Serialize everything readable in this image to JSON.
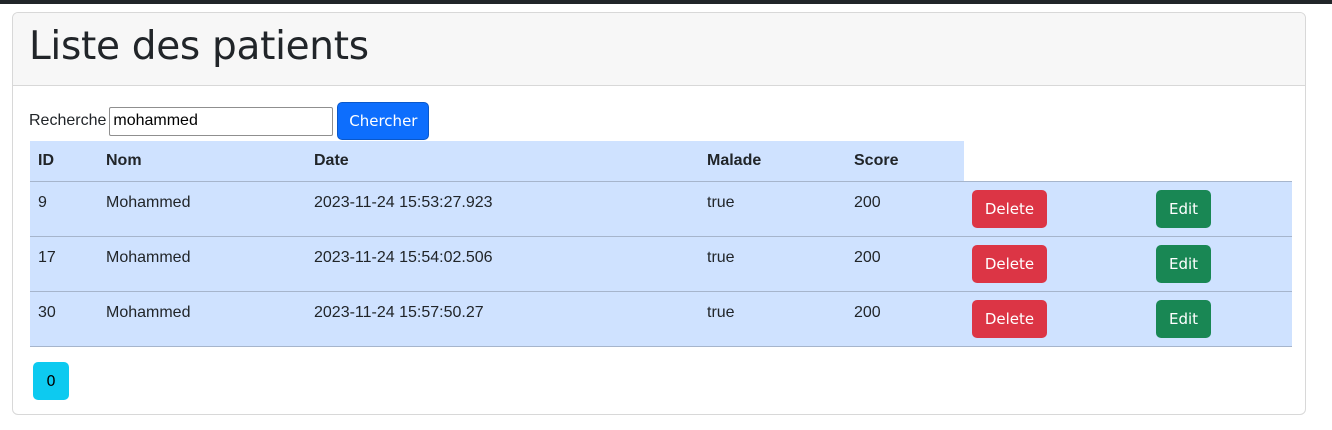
{
  "page": {
    "title": "Liste des patients"
  },
  "search": {
    "label": "Recherche",
    "value": "mohammed",
    "button_label": "Chercher"
  },
  "table": {
    "headers": [
      "ID",
      "Nom",
      "Date",
      "Malade",
      "Score"
    ],
    "rows": [
      {
        "id": "9",
        "nom": "Mohammed",
        "date": "2023-11-24 15:53:27.923",
        "malade": "true",
        "score": "200"
      },
      {
        "id": "17",
        "nom": "Mohammed",
        "date": "2023-11-24 15:54:02.506",
        "malade": "true",
        "score": "200"
      },
      {
        "id": "30",
        "nom": "Mohammed",
        "date": "2023-11-24 15:57:50.27",
        "malade": "true",
        "score": "200"
      }
    ],
    "delete_label": "Delete",
    "edit_label": "Edit"
  },
  "pagination": {
    "pages": [
      "0"
    ]
  },
  "colors": {
    "primary": "#0d6efd",
    "danger": "#dc3545",
    "success": "#198754",
    "info": "#0dcaf0",
    "table_bg": "#cfe2ff"
  }
}
